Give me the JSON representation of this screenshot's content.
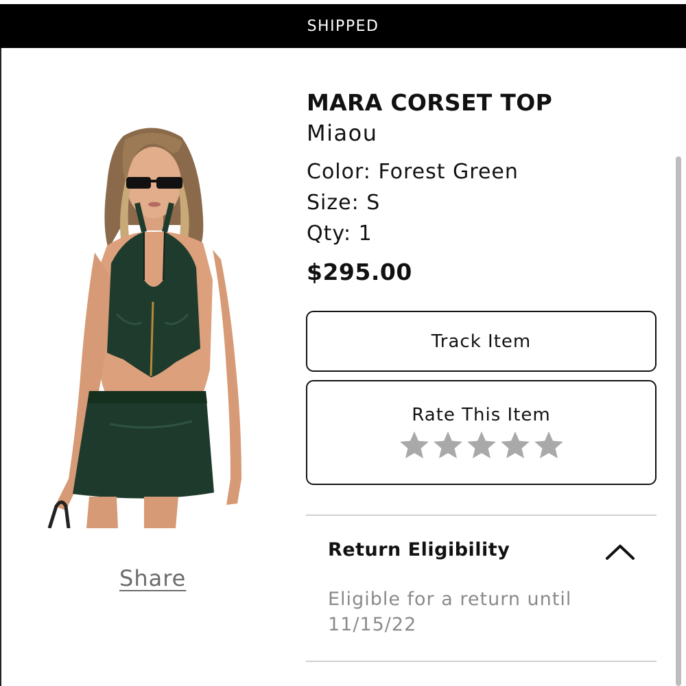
{
  "status_bar": {
    "label": "SHIPPED"
  },
  "product": {
    "title": "MARA CORSET TOP",
    "brand": "Miaou",
    "color": "Color: Forest Green",
    "size": "Size: S",
    "qty": "Qty: 1",
    "price": "$295.00",
    "image_icon": "product-photo"
  },
  "share": {
    "label": "Share"
  },
  "actions": {
    "track_label": "Track Item",
    "rate_label": "Rate This Item",
    "rating": {
      "value": 0,
      "max": 5
    }
  },
  "return_section": {
    "heading": "Return Eligibility",
    "text": "Eligible for a return until 11/15/22",
    "expanded": true
  },
  "colors": {
    "status_bar_bg": "#000000",
    "leather_green": "#1f3b2d",
    "star_gray": "#a9a9a9",
    "muted_text": "#8a8a8a"
  }
}
